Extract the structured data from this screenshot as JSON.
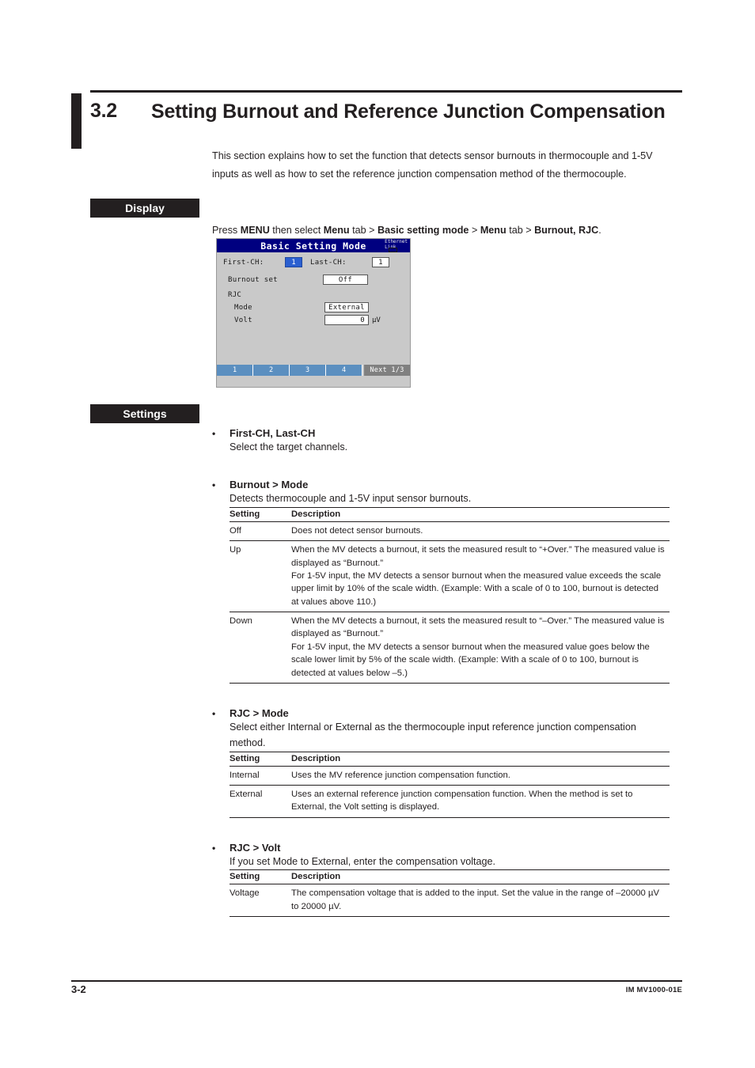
{
  "section": {
    "number": "3.2",
    "title": "Setting Burnout and Reference Junction Compensation",
    "intro": "This section explains how to set the function that detects sensor burnouts in thermocouple and 1-5V inputs as well as how to set the reference junction compensation method of the thermocouple."
  },
  "display_block": {
    "chip_label": "Display",
    "instruction": {
      "p1": "Press ",
      "b1": "MENU",
      "p2": " then select ",
      "b2": "Menu",
      "p3": " tab > ",
      "b3": "Basic setting mode",
      "p4": " > ",
      "b4": "Menu",
      "p5": " tab > ",
      "b5": "Burnout, RJC",
      "p6": "."
    }
  },
  "device": {
    "title": "Basic Setting Mode",
    "ethernet_label_line1": "Ethernet",
    "ethernet_label_line2": "Link",
    "fields": {
      "first_ch_label": "First-CH:",
      "first_ch_value": "1",
      "last_ch_label": "Last-CH:",
      "last_ch_value": "1",
      "burnout_label": "Burnout set",
      "burnout_value": "Off",
      "rjc_label": "RJC",
      "mode_label": "Mode",
      "mode_value": "External",
      "volt_label": "Volt",
      "volt_value": "0",
      "volt_unit": "µV"
    },
    "tabs": [
      "1",
      "2",
      "3",
      "4"
    ],
    "next_label": "Next 1/3",
    "colors": {
      "titlebar": "#000080",
      "tab": "#5b8fc0",
      "selection": "#2a5fd0",
      "screen_bg": "#c9c9c9",
      "next_bg": "#808080"
    }
  },
  "settings_block": {
    "chip_label": "Settings",
    "bullet": "•",
    "sections": [
      {
        "heading": "First-CH, Last-CH",
        "description": "Select the target channels.",
        "table": null
      },
      {
        "heading": "Burnout >  Mode",
        "description": "Detects thermocouple and 1-5V input sensor burnouts.",
        "table": {
          "headers": [
            "Setting",
            "Description"
          ],
          "rows": [
            {
              "setting": "Off",
              "description": "Does not detect sensor burnouts."
            },
            {
              "setting": "Up",
              "description": "When the MV detects a burnout, it sets the measured result to “+Over.” The measured value is displayed as “Burnout.”\nFor 1-5V input, the MV detects a sensor burnout when the measured value exceeds the scale upper limit by 10% of the scale width. (Example: With a scale of 0 to 100, burnout is detected at values above 110.)"
            },
            {
              "setting": "Down",
              "description": "When the MV detects a burnout, it sets the measured result to “–Over.” The measured value is displayed as “Burnout.”\nFor 1-5V input, the MV detects a sensor burnout when the measured value goes below the scale lower limit by 5% of the scale width. (Example: With a scale of 0 to 100, burnout is detected at values below –5.)"
            }
          ]
        }
      },
      {
        "heading": "RJC >  Mode",
        "description": "Select either Internal or External as the thermocouple input reference junction compensation method.",
        "table": {
          "headers": [
            "Setting",
            "Description"
          ],
          "rows": [
            {
              "setting": "Internal",
              "description": "Uses the MV reference junction compensation function."
            },
            {
              "setting": "External",
              "description": "Uses an external reference junction compensation function. When the method is set to External, the Volt setting is displayed."
            }
          ]
        }
      },
      {
        "heading": "RJC > Volt",
        "description": "If you set Mode to External, enter the compensation voltage.",
        "table": {
          "headers": [
            "Setting",
            "Description"
          ],
          "rows": [
            {
              "setting": "Voltage",
              "description": "The compensation voltage that is added to the input. Set the value in the range of –20000 µV to 20000 µV."
            }
          ]
        }
      }
    ]
  },
  "footer": {
    "page_number": "3-2",
    "document_id": "IM MV1000-01E"
  }
}
